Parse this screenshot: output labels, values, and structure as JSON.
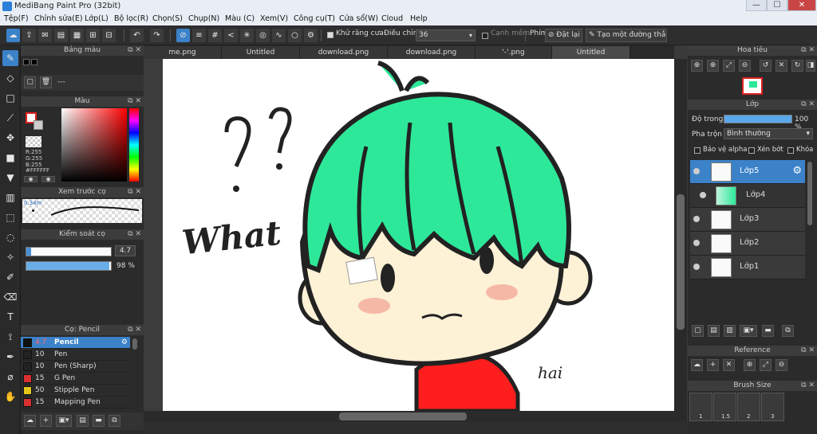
{
  "window": {
    "title": "MediBang Paint Pro (32bit)",
    "minimize": "—",
    "maximize": "☐",
    "close": "✕"
  },
  "menu": [
    "Tệp(F)",
    "Chỉnh sửa(E)",
    "Lớp(L)",
    "Bộ lọc(R)",
    "Chọn(S)",
    "Chụp(N)",
    "Màu (C)",
    "Xem(V)",
    "Công cụ(T)",
    "Cửa sổ(W)",
    "Cloud",
    "Help"
  ],
  "toolbar": {
    "antialias_label": "Khử răng cưa",
    "adjust_label": "Điều chỉnh",
    "adjust_value": "36",
    "edge_label": "Cạnh mềm",
    "key_label": "Phím",
    "reset_label": "Đặt lại",
    "line_label": "Tạo một đường thẳng"
  },
  "tabs": [
    "me.png",
    "Untitled",
    "download.png",
    "download.png",
    "'-'.png",
    "Untitled"
  ],
  "panels": {
    "palette": {
      "title": "Bảng màu",
      "dash": "---"
    },
    "color": {
      "title": "Màu",
      "r": "R:255",
      "g": "G:255",
      "b": "B:255",
      "hex": "#FFFFFF"
    },
    "preview": {
      "title": "Xem trước cọ",
      "size": "0.34m"
    },
    "brush_control": {
      "title": "Kiểm soát cọ",
      "size_value": "4.7",
      "opacity_value": "98 %"
    },
    "brushes": {
      "title": "Cọ: Pencil",
      "items": [
        {
          "size": "4.7",
          "name": "Pencil",
          "color": "#111111",
          "selected": true
        },
        {
          "size": "10",
          "name": "Pen",
          "color": "#222222"
        },
        {
          "size": "10",
          "name": "Pen (Sharp)",
          "color": "#222222"
        },
        {
          "size": "15",
          "name": "G Pen",
          "color": "#d93030"
        },
        {
          "size": "50",
          "name": "Stipple Pen",
          "color": "#e6c619"
        },
        {
          "size": "15",
          "name": "Mapping Pen",
          "color": "#d93030"
        }
      ]
    },
    "navigator": {
      "title": "Hoa tiêu"
    },
    "layer": {
      "title": "Lớp",
      "opacity_label": "Độ trong",
      "opacity_value": "100 %",
      "blend_label": "Pha trộn",
      "blend_value": "Bình thường",
      "protect_alpha": "Bảo vệ alpha",
      "clipping": "Xén bớt",
      "lock": "Khóa",
      "items": [
        "Lớp5",
        "Lớp4",
        "Lớp3",
        "Lớp2",
        "Lớp1"
      ]
    },
    "reference": {
      "title": "Reference"
    },
    "brush_size": {
      "title": "Brush Size",
      "sizes": [
        "1",
        "1.5",
        "2",
        "3"
      ]
    }
  },
  "canvas": {
    "text_what": "What",
    "text_q": "? ?",
    "signature": "hai"
  },
  "colors": {
    "accent": "#3b82c9",
    "hair": "#2ee89a",
    "skin": "#fdf1d6",
    "shirt": "#ff1e1e"
  }
}
